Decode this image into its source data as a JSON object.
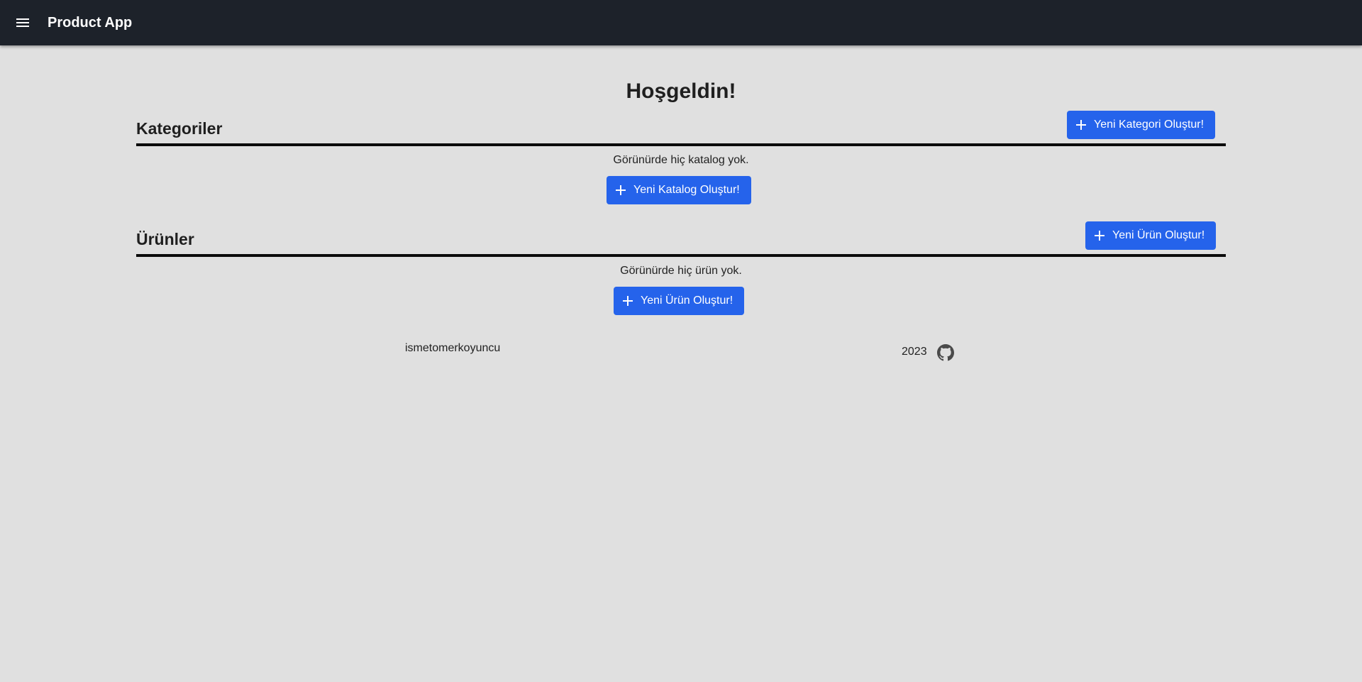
{
  "app": {
    "title": "Product App"
  },
  "welcome": "Hoşgeldin!",
  "categories": {
    "title": "Kategoriler",
    "create_button": "Yeni Kategori Oluştur!",
    "empty_text": "Görünürde hiç katalog yok.",
    "empty_button": "Yeni Katalog Oluştur!"
  },
  "products": {
    "title": "Ürünler",
    "create_button": "Yeni Ürün Oluştur!",
    "empty_text": "Görünürde hiç ürün yok.",
    "empty_button": "Yeni Ürün Oluştur!"
  },
  "footer": {
    "author": "ismetomerkoyuncu",
    "year": "2023"
  },
  "icons": {
    "menu": "menu-icon",
    "plus": "plus-icon",
    "github": "github-icon"
  },
  "colors": {
    "topbar": "#1d222a",
    "background": "#e0e0e0",
    "primary_button": "#2563eb"
  }
}
